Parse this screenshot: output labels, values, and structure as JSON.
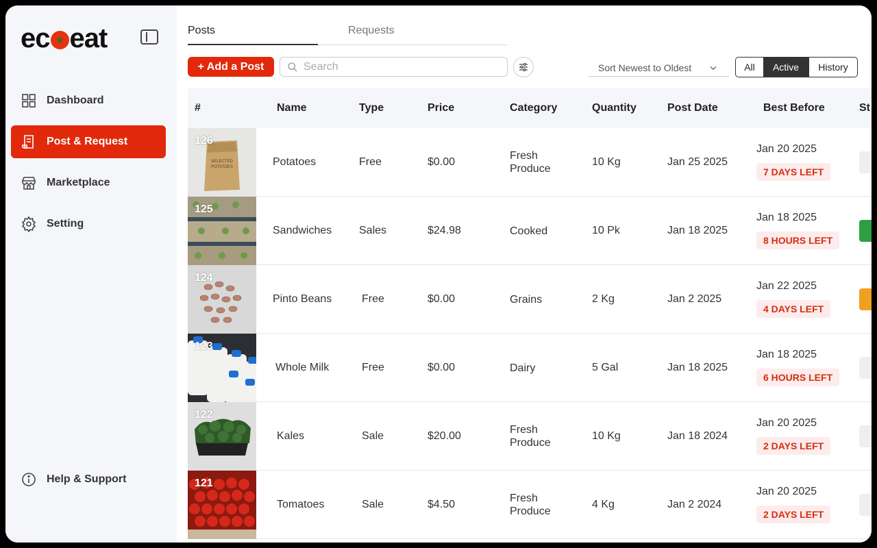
{
  "sidebar": {
    "logo": {
      "left": "ec",
      "right": "eat"
    },
    "nav": [
      {
        "label": "Dashboard",
        "icon": "grid-icon"
      },
      {
        "label": "Post & Request",
        "icon": "document-icon",
        "active": true
      },
      {
        "label": "Marketplace",
        "icon": "store-icon"
      },
      {
        "label": "Setting",
        "icon": "gear-icon"
      }
    ],
    "help": {
      "label": "Help & Support",
      "icon": "info-icon"
    }
  },
  "tabs": {
    "posts": "Posts",
    "requests": "Requests"
  },
  "toolbar": {
    "add_label": "+ Add a Post",
    "search_placeholder": "Search",
    "sort_label": "Sort Newest to Oldest",
    "segments": [
      "All",
      "Active",
      "History"
    ]
  },
  "table": {
    "headers": [
      "#",
      "Name",
      "Type",
      "Price",
      "Category",
      "Quantity",
      "Post Date",
      "Best Before",
      "St"
    ],
    "rows": [
      {
        "id": "126",
        "name": "Potatoes",
        "type": "Free",
        "price": "$0.00",
        "category": "Fresh Produce",
        "quantity": "10 Kg",
        "post_date": "Jan 25 2025",
        "best_before": "Jan 20 2025",
        "left": "7 DAYS LEFT",
        "status": "#eeeeee"
      },
      {
        "id": "125",
        "name": "Sandwiches",
        "type": "Sales",
        "price": "$24.98",
        "category": "Cooked",
        "quantity": "10 Pk",
        "post_date": "Jan 18 2025",
        "best_before": "Jan 18 2025",
        "left": "8 HOURS LEFT",
        "status": "#2ea043"
      },
      {
        "id": "124",
        "name": "Pinto Beans",
        "type": "Free",
        "price": "$0.00",
        "category": "Grains",
        "quantity": "2 Kg",
        "post_date": "Jan 2 2025",
        "best_before": "Jan 22 2025",
        "left": "4 DAYS LEFT",
        "status": "#f0a020"
      },
      {
        "id": "123",
        "name": "Whole Milk",
        "type": "Free",
        "price": "$0.00",
        "category": "Dairy",
        "quantity": "5 Gal",
        "post_date": "Jan 18 2025",
        "best_before": "Jan 18 2025",
        "left": "6 HOURS LEFT",
        "status": "#eeeeee"
      },
      {
        "id": "122",
        "name": "Kales",
        "type": "Sale",
        "price": "$20.00",
        "category": "Fresh Produce",
        "quantity": "10 Kg",
        "post_date": "Jan 18 2024",
        "best_before": "Jan 20 2025",
        "left": "2 DAYS LEFT",
        "status": "#eeeeee"
      },
      {
        "id": "121",
        "name": "Tomatoes",
        "type": "Sale",
        "price": "$4.50",
        "category": "Fresh Produce",
        "quantity": "4 Kg",
        "post_date": "Jan 2 2024",
        "best_before": "Jan 20 2025",
        "left": "2 DAYS LEFT",
        "status": "#eeeeee"
      }
    ]
  },
  "colors": {
    "accent": "#e2290c",
    "badge_text": "#d52d12",
    "badge_bg": "#fdeceb"
  }
}
